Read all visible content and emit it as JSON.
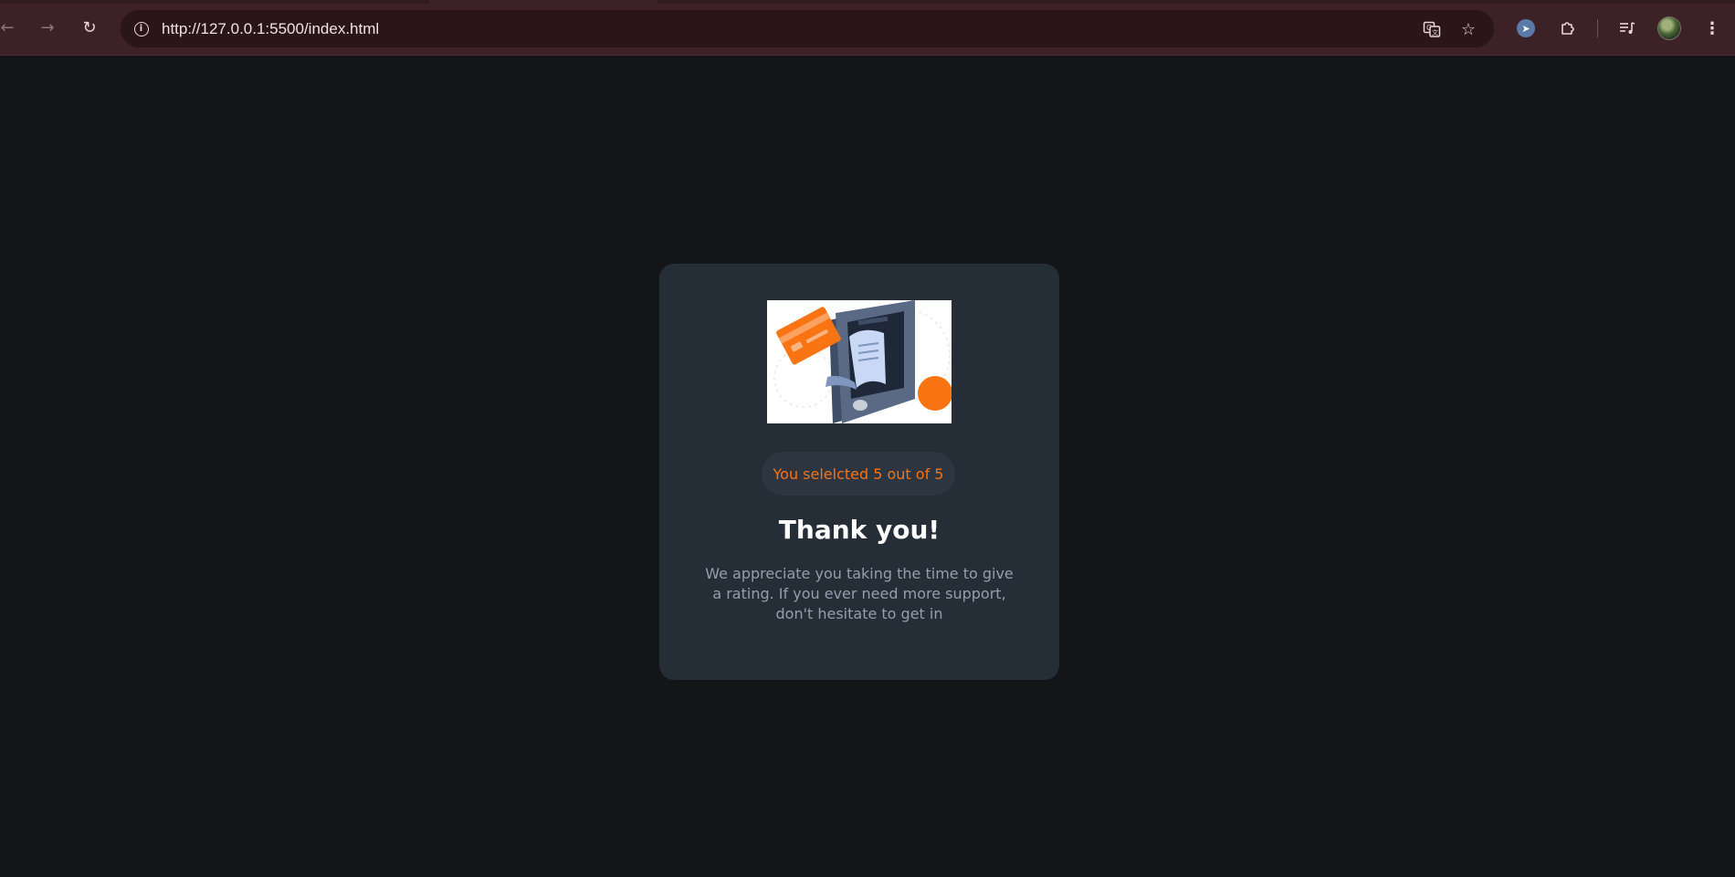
{
  "browser": {
    "url": "http://127.0.0.1:5500/index.html",
    "icons": {
      "back": "arrow-left-icon",
      "forward": "arrow-right-icon",
      "reload": "reload-icon",
      "site_info": "info-icon",
      "translate": "translate-icon",
      "bookmark": "star-icon",
      "extension_cursor": "cursor-extension-icon",
      "extensions": "puzzle-icon",
      "media": "media-control-icon",
      "profile": "avatar",
      "menu": "kebab-menu-icon"
    }
  },
  "card": {
    "rating_text": "You selelcted 5 out of 5",
    "title": "Thank you!",
    "message": "We appreciate you taking the time to give a rating. If you ever need more support, don't hesitate to get in"
  },
  "colors": {
    "page_background": "#131518",
    "card_background": "#252d37",
    "badge_background": "#2d3540",
    "accent_orange": "#fb7413",
    "title_text": "#ffffff",
    "body_text": "#959eac",
    "chrome_background": "#3c2226"
  }
}
